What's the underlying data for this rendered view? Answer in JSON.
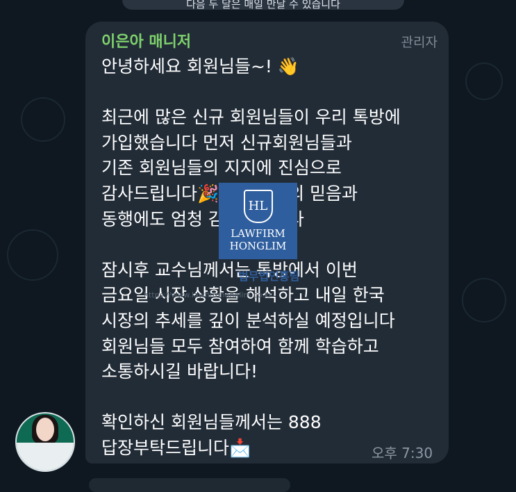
{
  "top_banner": {
    "text": "다음 두 달은 매일 만날 수 있습니다"
  },
  "message": {
    "sender": "이은아 매니저",
    "role": "관리자",
    "body": "안녕하세요 회원님들~! 👋\n\n최근에 많은 신규 회원님들이 우리 톡방에\n가입했습니다 먼저 신규회원님들과\n기존 회원님들의 지지에 진심으로\n감사드립니다🎉 회원님들의 믿음과\n동행에도 엄청 감사드립니다\n\n잠시후 교수님께서는 톡방에서 이번\n금요일 시장 상황을 해석하고 내일 한국\n시장의 추세를 깊이 분석하실 예정입니다\n회원님들 모두 참여하여 함께 학습하고\n소통하시길 바랍니다!\n\n확인하신 회원님들께서는 888\n답장부탁드립니다📩",
    "time": "오후 7:30"
  },
  "watermark": {
    "logo": "HL",
    "name1": "LAWFIRM",
    "name2": "HONGLIM",
    "sub": "법무법인홍림",
    "url": "https://www.lawfirmhonglim.co.kr"
  },
  "colors": {
    "background": "#0f1820",
    "bubble": "#222c37",
    "sender": "#7fd36c",
    "watermark": "#2f5e9e"
  }
}
